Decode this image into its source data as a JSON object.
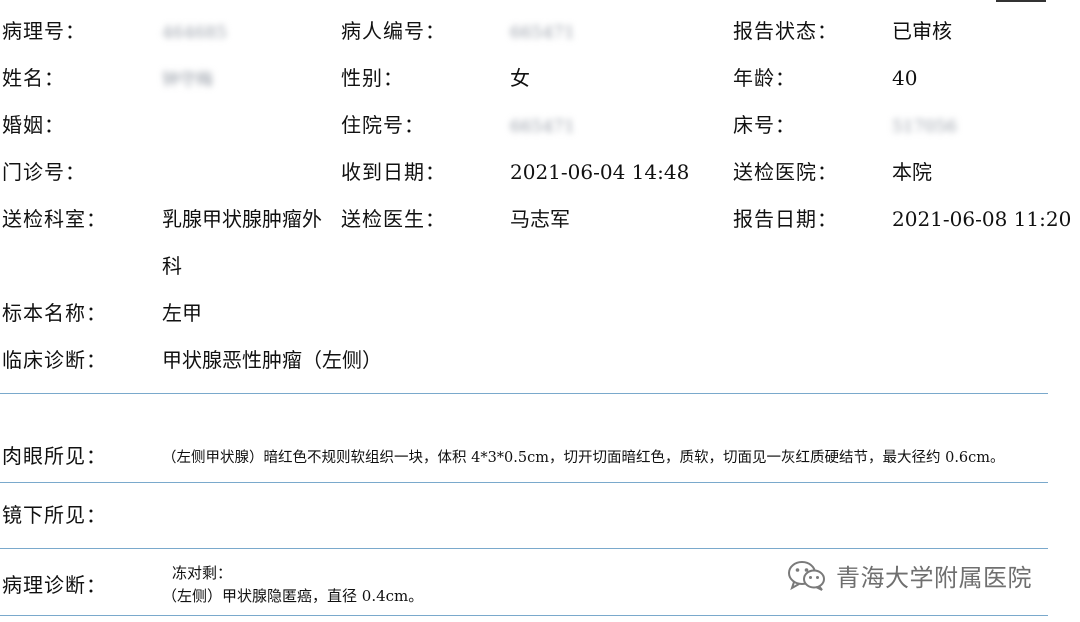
{
  "header": {
    "pathology_no": {
      "label": "病理号：",
      "value": "464685"
    },
    "patient_no": {
      "label": "病人编号：",
      "value": "665471"
    },
    "report_status": {
      "label": "报告状态：",
      "value": "已审核"
    },
    "name": {
      "label": "姓名：",
      "value": "钟守梅"
    },
    "gender": {
      "label": "性别：",
      "value": "女"
    },
    "age": {
      "label": "年龄：",
      "value": "40"
    },
    "marital": {
      "label": "婚姻：",
      "value": ""
    },
    "inpatient_no": {
      "label": "住院号：",
      "value": "665471"
    },
    "bed_no": {
      "label": "床号：",
      "value": "517056"
    },
    "outpatient_no": {
      "label": "门诊号：",
      "value": ""
    },
    "received_date": {
      "label": "收到日期：",
      "value": "2021-06-04 14:48"
    },
    "hospital": {
      "label": "送检医院：",
      "value": "本院"
    },
    "department": {
      "label": "送检科室：",
      "value": "乳腺甲状腺肿瘤外科"
    },
    "doctor": {
      "label": "送检医生：",
      "value": "马志军"
    },
    "report_date": {
      "label": "报告日期：",
      "value": "2021-06-08 11:20"
    },
    "specimen": {
      "label": "标本名称：",
      "value": "左甲"
    },
    "clinical_diagnosis": {
      "label": "临床诊断：",
      "value": "甲状腺恶性肿瘤（左侧）"
    }
  },
  "sections": {
    "gross": {
      "label": "肉眼所见：",
      "text": "（左侧甲状腺）暗红色不规则软组织一块，体积 4*3*0.5cm，切开切面暗红色，质软，切面见一灰红质硬结节，最大径约 0.6cm。"
    },
    "microscopic": {
      "label": "镜下所见：",
      "text": ""
    },
    "diagnosis": {
      "label": "病理诊断：",
      "line1": "冻对剩：",
      "line2": "（左侧）甲状腺隐匿癌，直径 0.4cm。"
    }
  },
  "watermark": {
    "text": "青海大学附属医院",
    "icon": "wechat-icon"
  }
}
